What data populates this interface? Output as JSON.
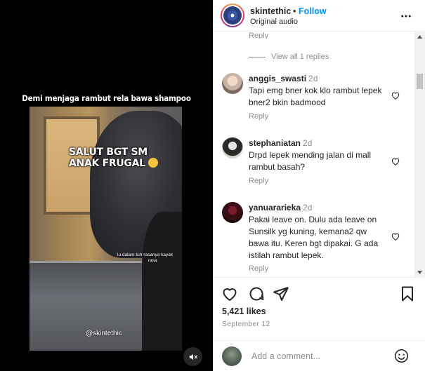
{
  "video": {
    "caption": "Demi menjaga rambut rela bawa shampoo",
    "overlay_line1": "SALUT BGT SM",
    "overlay_line2": "ANAK FRUGAL",
    "overlay_small": "lu dalam tuh rasanya kayak",
    "overlay_small_2": "rasa",
    "handle": "@skintethic",
    "mute_icon": "volume-muted-icon"
  },
  "header": {
    "username": "skintethic",
    "dot": "•",
    "follow_label": "Follow",
    "audio": "Original audio",
    "more_icon": "more-horizontal-icon"
  },
  "comments": {
    "partial_reply_label": "Reply",
    "view_replies_label": "View all 1 replies",
    "items": [
      {
        "user": "anggis_swasti",
        "time": "2d",
        "text": "Tapi emg bner kok klo rambut lepek bner2 bkin badmood",
        "reply_label": "Reply"
      },
      {
        "user": "stephaniatan",
        "time": "2d",
        "text": "Drpd lepek mending jalan di mall rambut basah?",
        "reply_label": "Reply"
      },
      {
        "user": "yanuararieka",
        "time": "2d",
        "text": "Pakai leave on. Dulu ada leave on Sunsilk yg kuning, kemana2 qw bawa itu. Keren bgt dipakai. G ada istilah rambut lepek.",
        "reply_label": "Reply"
      }
    ]
  },
  "actions": {
    "like_icon": "heart-icon",
    "comment_icon": "comment-icon",
    "share_icon": "share-icon",
    "save_icon": "bookmark-icon",
    "likes": "5,421 likes",
    "date": "September 12"
  },
  "add_comment": {
    "placeholder": "Add a comment...",
    "emoji_icon": "emoji-icon"
  },
  "colors": {
    "accent": "#0095f6",
    "muted_text": "#8e8e8e",
    "text": "#262626"
  }
}
